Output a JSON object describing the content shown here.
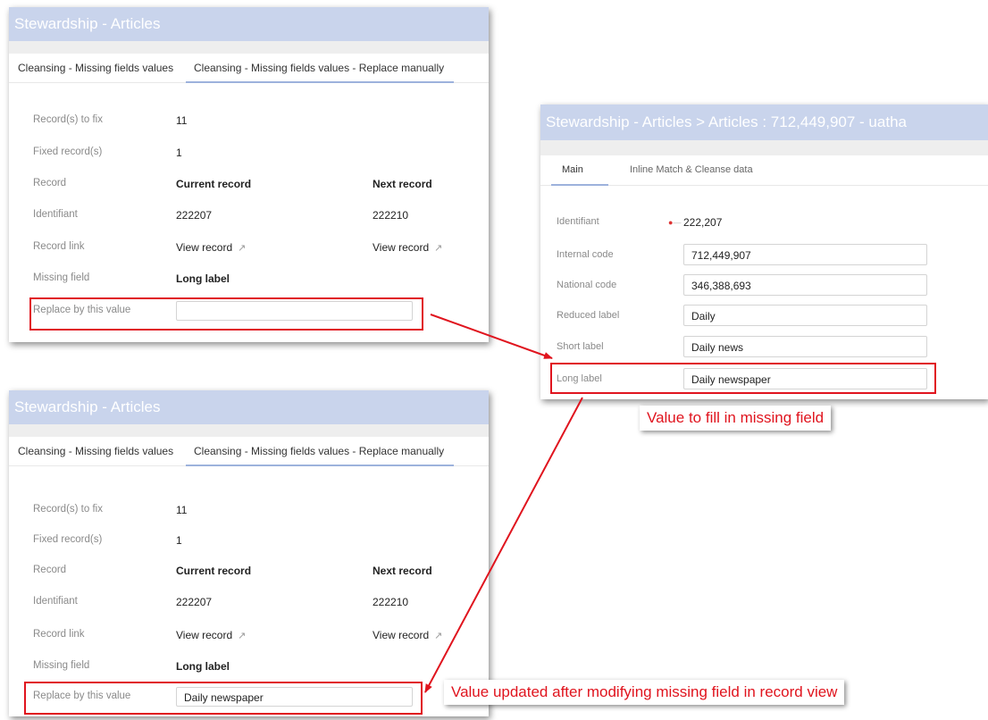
{
  "top_panel": {
    "title": "Stewardship - Articles",
    "tab1": "Cleansing - Missing fields values",
    "tab2": "Cleansing - Missing fields values - Replace manually",
    "records_to_fix_label": "Record(s) to fix",
    "records_to_fix_value": "11",
    "fixed_records_label": "Fixed record(s)",
    "fixed_records_value": "1",
    "record_label": "Record",
    "current_record": "Current record",
    "next_record": "Next record",
    "identifiant_label": "Identifiant",
    "identifiant_current": "222207",
    "identifiant_next": "222210",
    "record_link_label": "Record link",
    "view_record": "View record",
    "missing_field_label": "Missing field",
    "missing_field_value": "Long label",
    "replace_label": "Replace by this value",
    "replace_value": ""
  },
  "bottom_panel": {
    "title": "Stewardship - Articles",
    "tab1": "Cleansing - Missing fields values",
    "tab2": "Cleansing - Missing fields values - Replace manually",
    "records_to_fix_label": "Record(s) to fix",
    "records_to_fix_value": "11",
    "fixed_records_label": "Fixed record(s)",
    "fixed_records_value": "1",
    "record_label": "Record",
    "current_record": "Current record",
    "next_record": "Next record",
    "identifiant_label": "Identifiant",
    "identifiant_current": "222207",
    "identifiant_next": "222210",
    "record_link_label": "Record link",
    "view_record": "View record",
    "missing_field_label": "Missing field",
    "missing_field_value": "Long label",
    "replace_label": "Replace by this value",
    "replace_value": "Daily newspaper"
  },
  "record_panel": {
    "breadcrumb": "Stewardship - Articles  >  Articles : 712,449,907 - uatha",
    "tab_main": "Main",
    "tab_inline": "Inline Match & Cleanse data",
    "identifiant_label": "Identifiant",
    "identifiant_value": "222,207",
    "internal_code_label": "Internal code",
    "internal_code_value": "712,449,907",
    "national_code_label": "National code",
    "national_code_value": "346,388,693",
    "reduced_label_label": "Reduced label",
    "reduced_label_value": "Daily",
    "short_label_label": "Short label",
    "short_label_value": "Daily news",
    "long_label_label": "Long label",
    "long_label_value": "Daily newspaper"
  },
  "annotations": {
    "fill_missing": "Value to fill in missing field",
    "value_updated": "Value updated after modifying missing field in record view"
  },
  "colors": {
    "header_bg": "#c9d4ec",
    "tab_underline": "#9db2dc",
    "annotation_red": "#e0141e"
  },
  "icons": {
    "view_record": "external-link-icon",
    "identifiant": "status-flag-icon"
  }
}
